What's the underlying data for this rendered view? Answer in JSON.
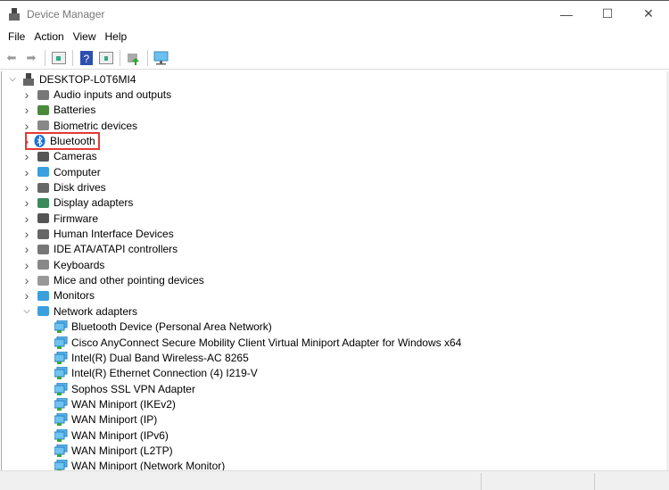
{
  "window": {
    "title": "Device Manager",
    "minimize": "—",
    "maximize": "☐",
    "close": "✕"
  },
  "menu": [
    "File",
    "Action",
    "View",
    "Help"
  ],
  "toolbar": {
    "icons": [
      "back-icon",
      "forward-icon",
      "show-hide-console-tree-icon",
      "help-icon",
      "properties-icon",
      "update-driver-icon",
      "scan-hardware-icon"
    ]
  },
  "tree": {
    "root": "DESKTOP-L0T6MI4",
    "categories": [
      {
        "label": "Audio inputs and outputs",
        "color": "#777"
      },
      {
        "label": "Batteries",
        "color": "#4a8a3a"
      },
      {
        "label": "Biometric devices",
        "color": "#888"
      },
      {
        "label": "Bluetooth",
        "color": "#1e6fd9",
        "highlighted": true
      },
      {
        "label": "Cameras",
        "color": "#555"
      },
      {
        "label": "Computer",
        "color": "#3aa0dd"
      },
      {
        "label": "Disk drives",
        "color": "#666"
      },
      {
        "label": "Display adapters",
        "color": "#3a8a5a"
      },
      {
        "label": "Firmware",
        "color": "#555"
      },
      {
        "label": "Human Interface Devices",
        "color": "#666"
      },
      {
        "label": "IDE ATA/ATAPI controllers",
        "color": "#777"
      },
      {
        "label": "Keyboards",
        "color": "#888"
      },
      {
        "label": "Mice and other pointing devices",
        "color": "#999"
      },
      {
        "label": "Monitors",
        "color": "#3aa0dd"
      },
      {
        "label": "Network adapters",
        "color": "#3aa0dd",
        "expanded": true
      }
    ],
    "network_adapters": [
      "Bluetooth Device (Personal Area Network)",
      "Cisco AnyConnect Secure Mobility Client Virtual Miniport Adapter for Windows x64",
      "Intel(R) Dual Band Wireless-AC 8265",
      "Intel(R) Ethernet Connection (4) I219-V",
      "Sophos SSL VPN Adapter",
      "WAN Miniport (IKEv2)",
      "WAN Miniport (IP)",
      "WAN Miniport (IPv6)",
      "WAN Miniport (L2TP)",
      "WAN Miniport (Network Monitor)"
    ]
  }
}
